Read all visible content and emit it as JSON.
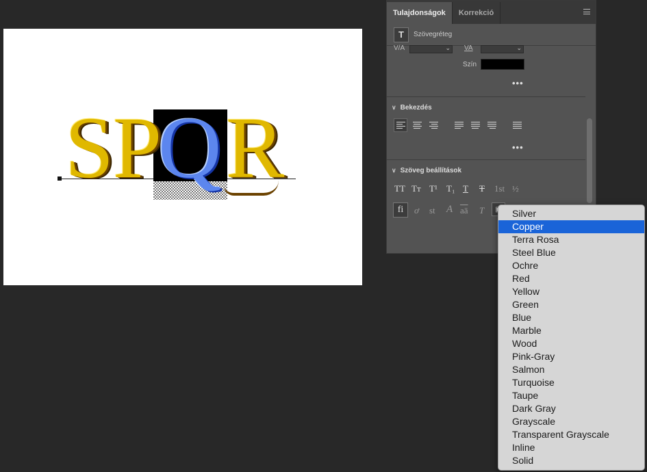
{
  "canvas": {
    "letters": [
      "S",
      "P",
      "Q",
      "R"
    ]
  },
  "panel": {
    "tabs": [
      {
        "label": "Tulajdonságok",
        "active": true
      },
      {
        "label": "Korrekció",
        "active": false
      }
    ],
    "layer_type_icon": "T",
    "layer_type_label": "Szövegréteg",
    "character": {
      "tracking_icon": "V/A",
      "kerning_icon": "VA",
      "color_label": "Szín",
      "color_value": "#000000",
      "more": "•••"
    },
    "paragraph": {
      "title": "Bekezdés",
      "more": "•••"
    },
    "text_options": {
      "title": "Szöveg beállítások",
      "row1": [
        "TT",
        "Tт",
        "T¹",
        "T₁",
        "T",
        "T",
        "1st",
        "½"
      ],
      "row2": [
        "fi",
        "ơ",
        "st",
        "A",
        "aā",
        "T"
      ]
    }
  },
  "dropdown": {
    "selected": "Copper",
    "items": [
      "Silver",
      "Copper",
      "Terra Rosa",
      "Steel Blue",
      "Ochre",
      "Red",
      "Yellow",
      "Green",
      "Blue",
      "Marble",
      "Wood",
      "Pink-Gray",
      "Salmon",
      "Turquoise",
      "Taupe",
      "Dark Gray",
      "Grayscale",
      "Transparent Grayscale",
      "Inline",
      "Solid"
    ]
  }
}
